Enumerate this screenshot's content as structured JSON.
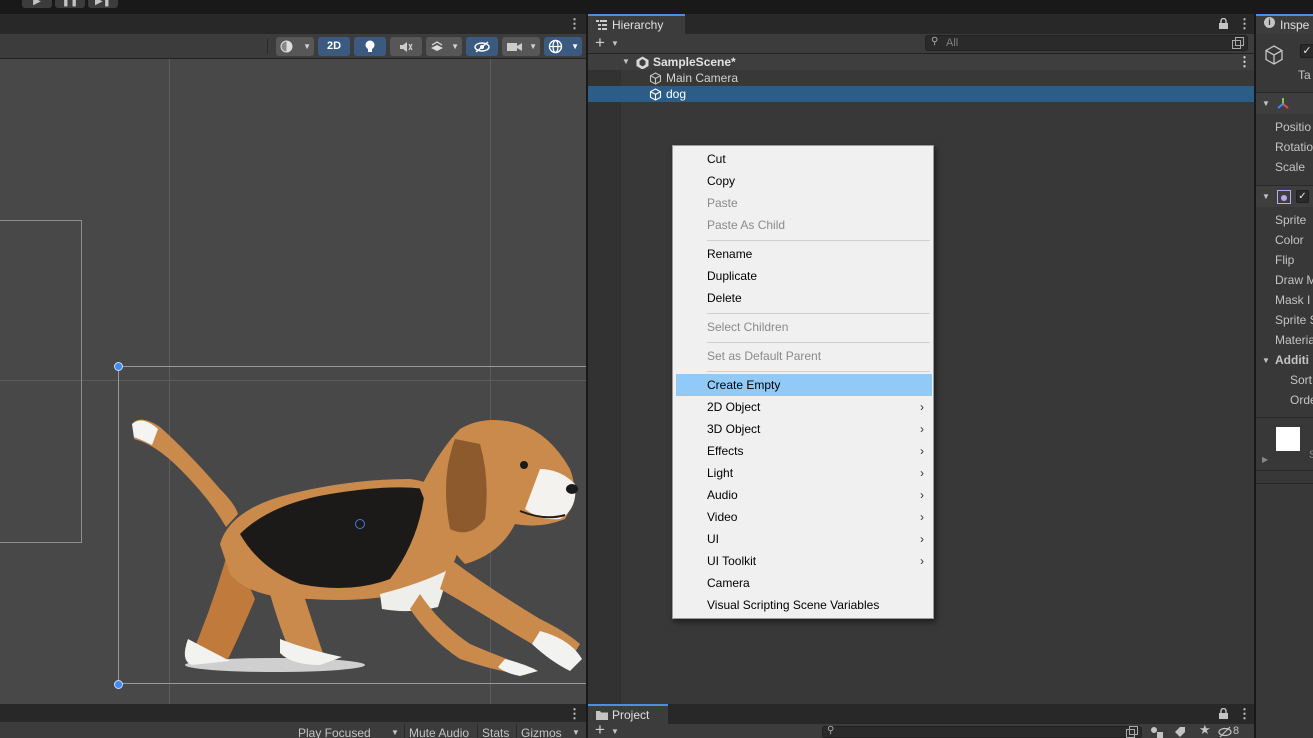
{
  "colors": {
    "accent_selected": "#2c5d87",
    "menu_highlight": "#91c9f7",
    "toolbar_active": "#3a5a80",
    "panel_bg": "#383838",
    "scene_bg": "#484848"
  },
  "scene_toolbar": {
    "mode_2d_label": "2D"
  },
  "scene_status": {
    "play_focused": "Play Focused",
    "mute_audio": "Mute Audio",
    "stats": "Stats",
    "gizmos": "Gizmos"
  },
  "hierarchy": {
    "tab_label": "Hierarchy",
    "search_placeholder": "All",
    "scene_name": "SampleScene*",
    "objects": [
      "Main Camera",
      "dog"
    ],
    "selected": "dog"
  },
  "project": {
    "tab_label": "Project",
    "hidden_count": "8"
  },
  "inspector": {
    "tab_label": "Inspe",
    "tag_label": "Ta",
    "transform_fields": [
      "Positio",
      "Rotatio",
      "Scale"
    ],
    "sprite_fields": [
      "Sprite",
      "Color",
      "Flip",
      "Draw M",
      "Mask I",
      "Sprite S",
      "Materia"
    ],
    "additional_header": "Additi",
    "additional_fields": [
      "Sort",
      "Orde"
    ],
    "preview_caption": "S"
  },
  "context_menu": {
    "items": [
      {
        "label": "Cut",
        "disabled": false
      },
      {
        "label": "Copy",
        "disabled": false
      },
      {
        "label": "Paste",
        "disabled": true
      },
      {
        "label": "Paste As Child",
        "disabled": true
      },
      {
        "label": "Rename",
        "disabled": false
      },
      {
        "label": "Duplicate",
        "disabled": false
      },
      {
        "label": "Delete",
        "disabled": false
      },
      {
        "label": "Select Children",
        "disabled": true
      },
      {
        "label": "Set as Default Parent",
        "disabled": true
      },
      {
        "label": "Create Empty",
        "disabled": false,
        "highlighted": true
      },
      {
        "label": "2D Object",
        "submenu": true
      },
      {
        "label": "3D Object",
        "submenu": true
      },
      {
        "label": "Effects",
        "submenu": true
      },
      {
        "label": "Light",
        "submenu": true
      },
      {
        "label": "Audio",
        "submenu": true
      },
      {
        "label": "Video",
        "submenu": true
      },
      {
        "label": "UI",
        "submenu": true
      },
      {
        "label": "UI Toolkit",
        "submenu": true
      },
      {
        "label": "Camera",
        "submenu": false
      },
      {
        "label": "Visual Scripting Scene Variables",
        "submenu": false
      }
    ]
  },
  "icons": {
    "play": "play-icon",
    "pause": "pause-icon",
    "step": "step-icon",
    "more": "kebab-icon",
    "lock": "lock-icon",
    "add": "plus-icon",
    "gameobject": "cube-icon",
    "scene": "unity-logo-icon"
  }
}
